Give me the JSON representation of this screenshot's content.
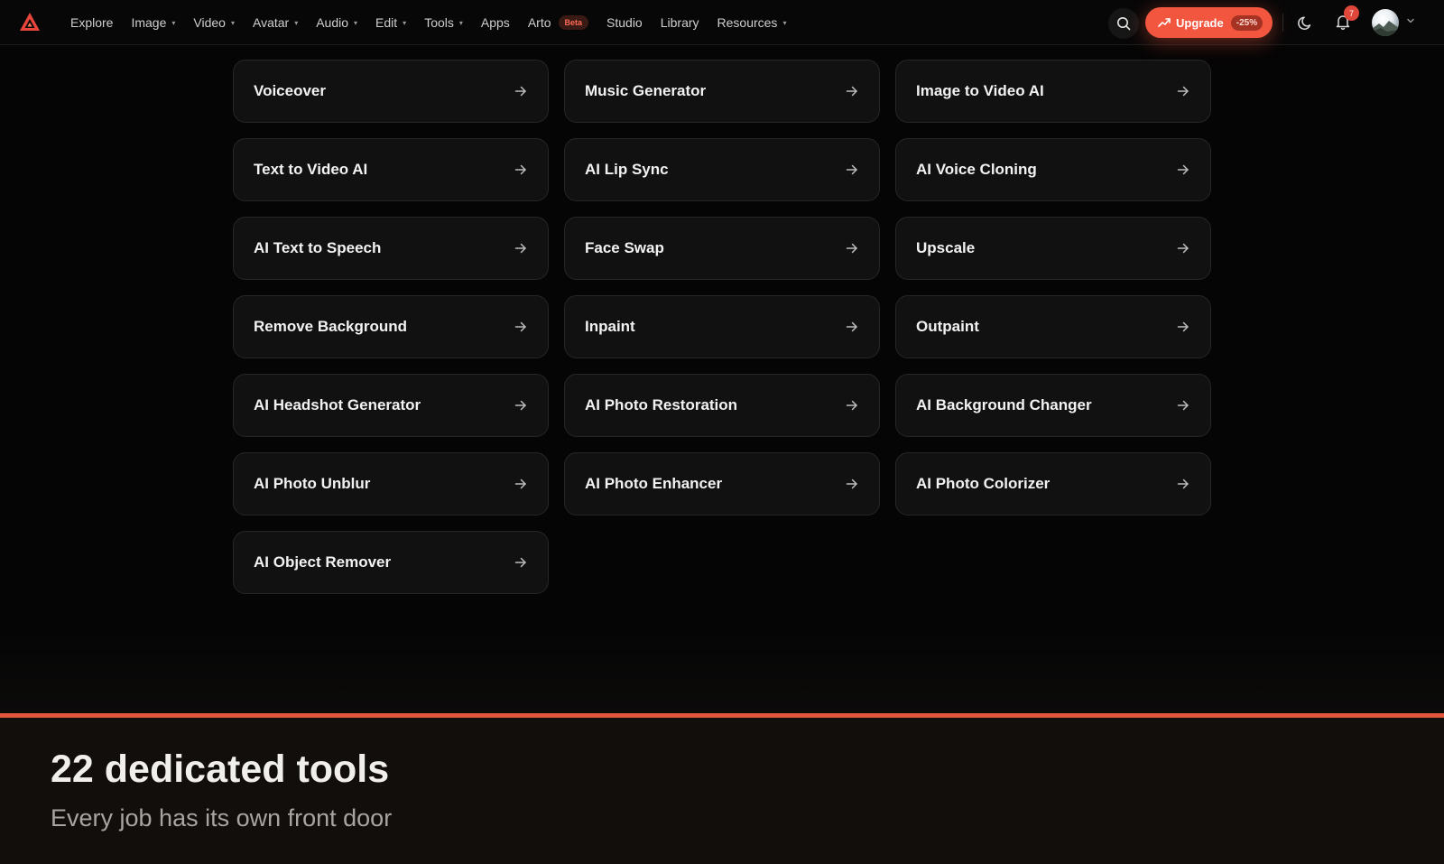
{
  "nav": {
    "items": [
      {
        "label": "Explore",
        "dropdown": false
      },
      {
        "label": "Image",
        "dropdown": true
      },
      {
        "label": "Video",
        "dropdown": true
      },
      {
        "label": "Avatar",
        "dropdown": true
      },
      {
        "label": "Audio",
        "dropdown": true
      },
      {
        "label": "Edit",
        "dropdown": true
      },
      {
        "label": "Tools",
        "dropdown": true
      },
      {
        "label": "Apps",
        "dropdown": false
      },
      {
        "label": "Arto",
        "dropdown": false,
        "badge": "Beta"
      },
      {
        "label": "Studio",
        "dropdown": false
      },
      {
        "label": "Library",
        "dropdown": false
      },
      {
        "label": "Resources",
        "dropdown": true
      }
    ],
    "upgrade": {
      "label": "Upgrade",
      "discount": "-25%"
    },
    "notification_count": "7",
    "icons": [
      "search-icon",
      "trend-up-icon",
      "moon-icon",
      "bell-icon",
      "chevron-down-icon",
      "arrow-right-icon"
    ]
  },
  "tools": [
    "Voiceover",
    "Music Generator",
    "Image to Video AI",
    "Text to Video AI",
    "AI Lip Sync",
    "AI Voice Cloning",
    "AI Text to Speech",
    "Face Swap",
    "Upscale",
    "Remove Background",
    "Inpaint",
    "Outpaint",
    "AI Headshot Generator",
    "AI Photo Restoration",
    "AI Background Changer",
    "AI Photo Unblur",
    "AI Photo Enhancer",
    "AI Photo Colorizer",
    "AI Object Remover"
  ],
  "section": {
    "title": "22 dedicated tools",
    "subtitle": "Every job has its own front door"
  },
  "colors": {
    "accent": "#f2563f",
    "background": "#050505",
    "card": "#111112",
    "panel": "#110e0c"
  }
}
